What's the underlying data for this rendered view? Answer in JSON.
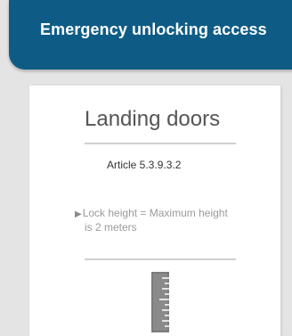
{
  "header": {
    "title": "Emergency unlocking access"
  },
  "panel": {
    "title": "Landing doors",
    "article": "Article 5.3.9.3.2",
    "note": {
      "line1": "Lock height = Maximum height",
      "line2": "is 2 meters"
    }
  },
  "icons": {
    "bullet": "arrow-right-icon",
    "ruler": "ruler-icon"
  },
  "colors": {
    "header": "#0e5c86",
    "background": "#e4e4e4",
    "panel": "#ffffff",
    "ruler": "#8a8a8a"
  }
}
